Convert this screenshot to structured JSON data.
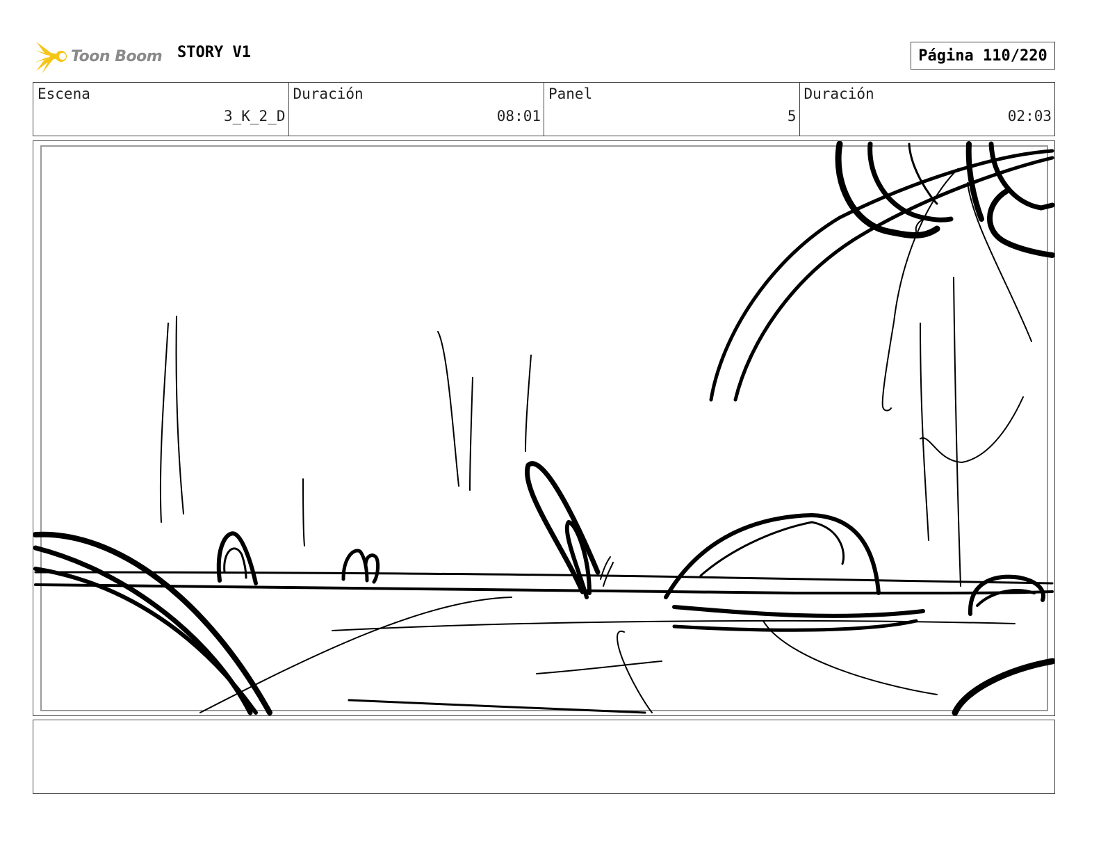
{
  "header": {
    "logo_text": "Toon Boom",
    "story_title": "STORY V1",
    "page_label": "Página 110/220"
  },
  "info": {
    "scene_label": "Escena",
    "scene_value": "3_K_2_D",
    "scene_duration_label": "Duración",
    "scene_duration_value": "08:01",
    "panel_label": "Panel",
    "panel_value": "5",
    "panel_duration_label": "Duración",
    "panel_duration_value": "02:03"
  },
  "notes": {
    "text": ""
  },
  "colors": {
    "logo_accent": "#f5c518",
    "logo_text": "#8a8a8a",
    "border": "#444444",
    "sketch_ink": "#000000"
  }
}
